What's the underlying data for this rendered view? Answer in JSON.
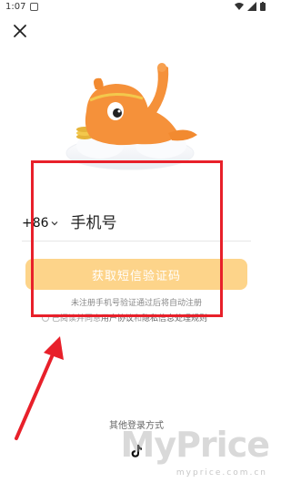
{
  "status_bar": {
    "time": "1:07"
  },
  "login": {
    "country_code": "+86",
    "phone_placeholder": "手机号",
    "sms_button_label": "获取短信验证码",
    "hint": "未注册手机号验证通过后将自动注册",
    "agreement": {
      "prefix": "已阅读并同意",
      "user_agreement": "用户协议",
      "conjunction": "和",
      "privacy_policy": "隐私信息处理规则"
    },
    "other_methods_label": "其他登录方式"
  },
  "watermark": {
    "main": "MyPrice",
    "sub": "myprice.com.cn"
  },
  "colors": {
    "accent": "#fdd48a",
    "annotation": "#e8202a",
    "mascot": "#f5913a"
  },
  "icons": [
    "close-icon",
    "chevron-down-icon",
    "tiktok-icon",
    "wifi-icon",
    "signal-icon",
    "battery-icon"
  ]
}
